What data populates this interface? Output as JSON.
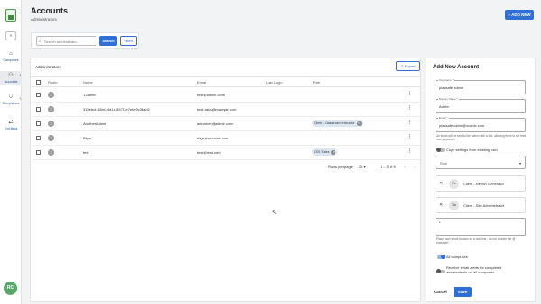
{
  "sidebar": {
    "expand_icon": "»",
    "items": [
      {
        "label": "Campuses",
        "icon": "home-icon"
      },
      {
        "label": "Accounts",
        "icon": "users-icon"
      },
      {
        "label": "Compliance",
        "icon": "shield-icon"
      },
      {
        "label": "Exit Beta",
        "icon": "exit-icon"
      }
    ],
    "avatar_initials": "RC"
  },
  "header": {
    "title": "Accounts",
    "subtitle": "Administrators",
    "add_new_label": "+ ADD NEW"
  },
  "search": {
    "placeholder": "Search administrato...",
    "search_label": "Search",
    "filters_label": "Filters"
  },
  "table": {
    "label": "Administrators",
    "export_label": "Export",
    "columns": [
      "Photo",
      "Name",
      "Email",
      "Last Login",
      "Role"
    ],
    "rows": [
      {
        "name": "1 Admin",
        "email": "test@admin.com",
        "last_login": "",
        "role": ""
      },
      {
        "name": "310ebcb-60eb-4a1a-8575-e7e6e9c33ad2",
        "email": "test-data@example.com",
        "last_login": "",
        "role": ""
      },
      {
        "name": "Another Admin",
        "email": "adnother@admin.com",
        "last_login": "",
        "role": "Client - Classroom Instructor"
      },
      {
        "name": "Rhys",
        "email": "rhys@account.com",
        "last_login": "",
        "role": ""
      },
      {
        "name": "test",
        "email": "test@test.com",
        "last_login": "",
        "role": "CSS Sales"
      }
    ],
    "pagination": {
      "rows_per_page_label": "Rows per page:",
      "rows_per_page": "25",
      "range": "1 – 5 of 5"
    }
  },
  "form": {
    "title": "Add New Account",
    "username_label": "Username *",
    "username_value": "plansafe admin",
    "display_name_label": "Display Name *",
    "display_name_value": "Admin",
    "email_label": "Email *",
    "email_value": "plansafeadmin@ocahix.com",
    "email_help": "An email will be sent to the admin with a link, allowing them to set their own password.",
    "copy_settings_label": "Copy settings from existing user",
    "role_placeholder": "Role",
    "assigned_roles": [
      {
        "initials": "Rc",
        "label": "Client - Report Generator"
      },
      {
        "initials": "Sa",
        "label": "Client - Site Administrator"
      }
    ],
    "domains_value": "*",
    "domains_help": "Place each email domain on a new line - do not include the @ character.",
    "all_campuses_label": "All campuses",
    "email_alerts_label": "Receive email alerts for completed assessments on all campuses.",
    "cancel_label": "Cancel",
    "save_label": "Save"
  },
  "colors": {
    "primary": "#2f6fd6",
    "avatar": "#57a86a",
    "chip": "#dce6f3"
  }
}
